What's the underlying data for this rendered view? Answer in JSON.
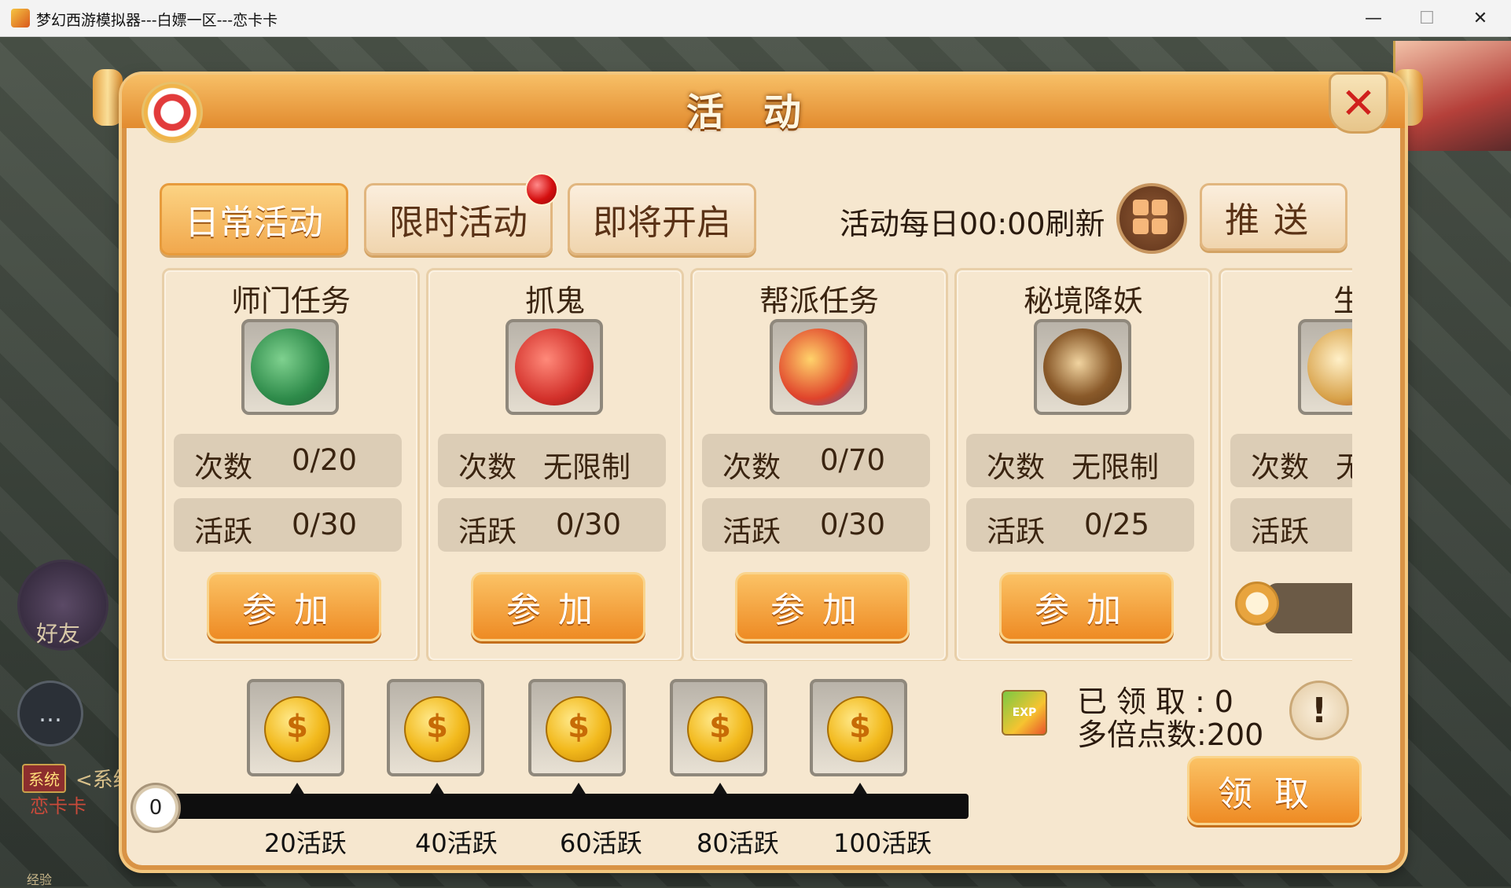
{
  "window": {
    "title": "梦幻西游模拟器---白嫖一区---恋卡卡",
    "minimize": "—",
    "maximize": "☐",
    "close": "✕"
  },
  "background": {
    "friend_label": "好友",
    "chat_icon": "chat-bubble-icon",
    "system_badge": "系统",
    "system_text": "<系统",
    "system_name": "恋卡卡",
    "exp_label": "经验"
  },
  "panel": {
    "title": "活动",
    "close_icon": "close-x-icon",
    "tabs": [
      {
        "label": "日常活动",
        "active": true
      },
      {
        "label": "限时活动",
        "active": false,
        "has_alert": true
      },
      {
        "label": "即将开启",
        "active": false
      }
    ],
    "refresh_text": "活动每日00:00刷新",
    "grid_icon": "grid-menu-icon",
    "push_label": "推送"
  },
  "activities": [
    {
      "name": "师门任务",
      "icon": "money-bag-icon",
      "count_label": "次数",
      "count": "0/20",
      "active_label": "活跃",
      "active": "0/30",
      "button": "参加",
      "color": "#2e8b4a"
    },
    {
      "name": "抓鬼",
      "icon": "red-charm-icon",
      "count_label": "次数",
      "count": "无限制",
      "active_label": "活跃",
      "active": "0/30",
      "button": "参加",
      "color": "#d3312b"
    },
    {
      "name": "帮派任务",
      "icon": "banner-sword-icon",
      "count_label": "次数",
      "count": "0/70",
      "active_label": "活跃",
      "active": "0/30",
      "button": "参加",
      "color": "#e0432b"
    },
    {
      "name": "秘境降妖",
      "icon": "crossbow-icon",
      "count_label": "次数",
      "count": "无限制",
      "active_label": "活跃",
      "active": "0/25",
      "button": "参加",
      "color": "#8a5a2a"
    },
    {
      "name": "生死",
      "icon": "scroll-icon",
      "count_label": "次数",
      "count": "无",
      "active_label": "活跃",
      "active": "",
      "button": "",
      "color": "#d8a24a"
    }
  ],
  "progress": {
    "start": "0",
    "current": 0,
    "max": 100,
    "milestones": [
      {
        "label": "20活跃",
        "value": 20
      },
      {
        "label": "40活跃",
        "value": 40
      },
      {
        "label": "60活跃",
        "value": 60
      },
      {
        "label": "80活跃",
        "value": 80
      },
      {
        "label": "100活跃",
        "value": 100
      }
    ],
    "reward_icon": "gold-coin-icon"
  },
  "claim": {
    "exp_icon": "exp-boost-icon",
    "exp_icon_text": "EXP",
    "claimed": "已领取:0",
    "multiplier": "多倍点数:200",
    "info_icon": "exclamation-icon",
    "info_glyph": "!",
    "button": "领取"
  }
}
